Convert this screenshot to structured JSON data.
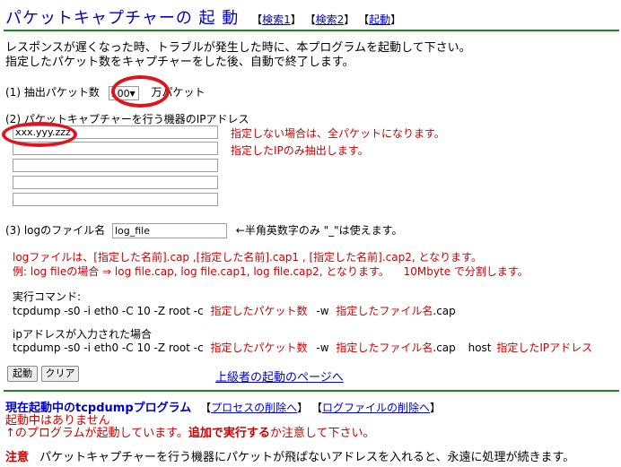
{
  "header": {
    "title": "パケットキャプチャーの 起 動",
    "links": [
      {
        "pre": "【",
        "label": "検索1",
        "post": "】"
      },
      {
        "pre": "【",
        "label": "検索2",
        "post": "】"
      },
      {
        "pre": "【",
        "label": "起動",
        "post": "】"
      }
    ]
  },
  "intro": {
    "line1": "レスポンスが遅くなった時、トラブルが発生した時に、本プログラムを起動して下さい。",
    "line2": "指定したパケット数をキャプチャーをした後、自動で終了します。"
  },
  "section1": {
    "label": "(1) 抽出パケット数",
    "select_value": "100",
    "suffix": "万パケット"
  },
  "section2": {
    "label": "(2) パケットキャプチャーを行う機器のIPアドレス",
    "ip_values": [
      "xxx.yyy.zzz",
      "",
      "",
      "",
      "",
      ""
    ],
    "hint1": "指定しない場合は、全パケットになります。",
    "hint2": "指定したIPのみ抽出します。"
  },
  "section3": {
    "label": "(3) logのファイル名",
    "value": "log_file",
    "hint": "←半角英数字のみ \"_\"は使えます。"
  },
  "log_notes": {
    "line1": "logファイルは、[指定した名前].cap ,[指定した名前].cap1 , [指定した名前].cap2, となります。",
    "line2": "例: log fileの場合 ⇒ log file.cap, log file.cap1, log file.cap2, となります。",
    "line2_extra": "10Mbyte で分割します。"
  },
  "command": {
    "label": "実行コマンド:",
    "prefix": "tcpdump -s0 -i eth0 -C 10 -Z root -c",
    "packets": "指定したパケット数",
    "w": "-w",
    "file": "指定したファイル名",
    "ext": ".cap"
  },
  "command_ip": {
    "label": "ipアドレスが入力された場合",
    "prefix": "tcpdump -s0 -i eth0 -C 10 -Z root -c",
    "packets": "指定したパケット数",
    "w": "-w",
    "file": "指定したファイル名",
    "ext": ".cap",
    "host": "host",
    "ip": "指定したIPアドレス"
  },
  "buttons": {
    "start": "起動",
    "clear": "クリア",
    "advanced_link": "上級者の起動のページへ"
  },
  "running": {
    "title": "現在起動中のtcpdumpプログラム",
    "links": [
      {
        "pre": "【",
        "label": "プロセスの削除へ",
        "post": "】"
      },
      {
        "pre": "【",
        "label": "ログファイルの削除へ",
        "post": "】"
      }
    ],
    "status": "起動中はありません",
    "warn_pre": "↑のプログラムが起動しています。",
    "warn_bold": "追加で実行する",
    "warn_post": "か注意して下さい。"
  },
  "caution": {
    "label": "注意",
    "text": "パケットキャプチャーを行う機器にパケットが飛ばないアドレスを入れると、永遠に処理が続きます。"
  },
  "colors": {
    "title": "#0000cc",
    "rule": "#1a8a1a",
    "warning": "#cc0000",
    "highlight_circle": "#e0141e"
  }
}
